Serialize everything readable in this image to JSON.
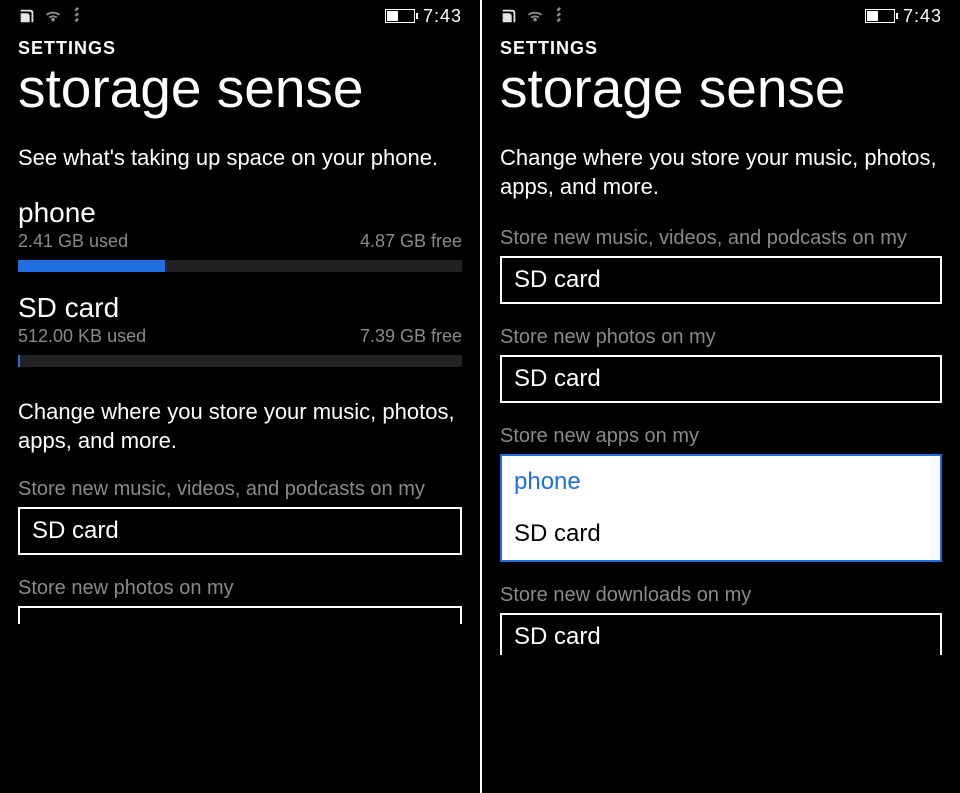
{
  "statusbar": {
    "time": "7:43"
  },
  "left": {
    "header_small": "SETTINGS",
    "header_big": "storage sense",
    "intro": "See what's taking up space on your phone.",
    "phone": {
      "name": "phone",
      "used": "2.41 GB used",
      "free": "4.87 GB free",
      "fill_pct": 33
    },
    "sd": {
      "name": "SD card",
      "used": "512.00 KB used",
      "free": "7.39 GB free",
      "fill_pct": 0.3
    },
    "change_text": "Change where you store your music, photos, apps, and more.",
    "music_label": "Store new music, videos, and podcasts on my",
    "music_value": "SD card",
    "photos_label": "Store new photos on my"
  },
  "right": {
    "header_small": "SETTINGS",
    "header_big": "storage sense",
    "change_text": "Change where you store your music, photos, apps, and more.",
    "music_label": "Store new music, videos, and podcasts on my",
    "music_value": "SD card",
    "photos_label": "Store new photos on my",
    "photos_value": "SD card",
    "apps_label": "Store new apps on my",
    "apps_options": {
      "opt1": "phone",
      "opt2": "SD card"
    },
    "downloads_label": "Store new downloads on my",
    "downloads_value": "SD card"
  }
}
